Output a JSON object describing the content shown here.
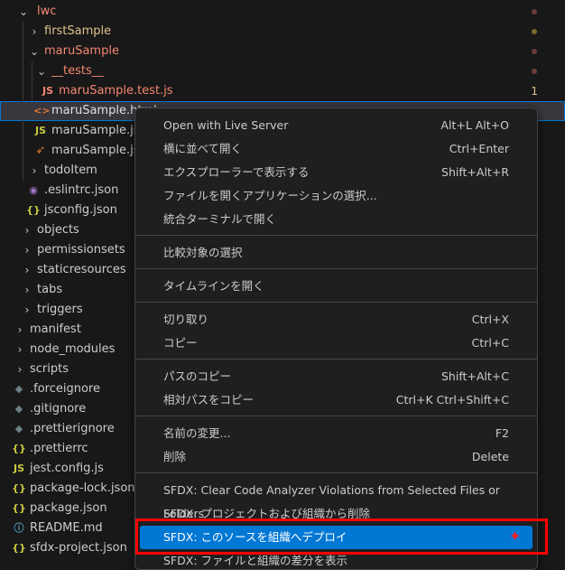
{
  "tree": [
    {
      "label": "lwc",
      "color": "#f48771",
      "dot": "r"
    },
    {
      "label": "firstSample",
      "color": "#e2c08d",
      "dot": "y"
    },
    {
      "label": "maruSample",
      "color": "#f48771",
      "dot": "r"
    },
    {
      "label": "__tests__",
      "color": "#f48771",
      "dot": "r"
    },
    {
      "label": "maruSample.test.js",
      "color": "#f48771",
      "icon": "JS",
      "badge": "1"
    },
    {
      "label": "maruSample.html",
      "icon": "<>"
    },
    {
      "label": "maruSample.js",
      "icon": "JS"
    },
    {
      "label": "maruSample.js-m",
      "icon": "rss"
    },
    {
      "label": "todoItem"
    },
    {
      "label": ".eslintrc.json"
    },
    {
      "label": "jsconfig.json",
      "icon": "{}"
    },
    {
      "label": "objects"
    },
    {
      "label": "permissionsets"
    },
    {
      "label": "staticresources"
    },
    {
      "label": "tabs"
    },
    {
      "label": "triggers"
    },
    {
      "label": "manifest"
    },
    {
      "label": "node_modules"
    },
    {
      "label": "scripts"
    },
    {
      "label": ".forceignore"
    },
    {
      "label": ".gitignore"
    },
    {
      "label": ".prettierignore"
    },
    {
      "label": ".prettierrc",
      "icon": "{}"
    },
    {
      "label": "jest.config.js",
      "icon": "JS"
    },
    {
      "label": "package-lock.json",
      "icon": "{}"
    },
    {
      "label": "package.json",
      "icon": "{}"
    },
    {
      "label": "README.md",
      "icon": "i"
    },
    {
      "label": "sfdx-project.json",
      "icon": "{}"
    }
  ],
  "menu": {
    "open_live": {
      "label": "Open with Live Server",
      "key": "Alt+L Alt+O"
    },
    "open_side": {
      "label": "横に並べて開く",
      "key": "Ctrl+Enter"
    },
    "reveal": {
      "label": "エクスプローラーで表示する",
      "key": "Shift+Alt+R"
    },
    "open_with": {
      "label": "ファイルを開くアプリケーションの選択..."
    },
    "terminal": {
      "label": "統合ターミナルで開く"
    },
    "compare": {
      "label": "比較対象の選択"
    },
    "timeline": {
      "label": "タイムラインを開く"
    },
    "cut": {
      "label": "切り取り",
      "key": "Ctrl+X"
    },
    "copy": {
      "label": "コピー",
      "key": "Ctrl+C"
    },
    "copy_path": {
      "label": "パスのコピー",
      "key": "Shift+Alt+C"
    },
    "copy_rel": {
      "label": "相対パスをコピー",
      "key": "Ctrl+K Ctrl+Shift+C"
    },
    "rename": {
      "label": "名前の変更...",
      "key": "F2"
    },
    "delete": {
      "label": "削除",
      "key": "Delete"
    },
    "sfdx_clear": {
      "label": "SFDX: Clear Code Analyzer Violations from Selected Files or Folders"
    },
    "sfdx_delete": {
      "label": "SFDX: プロジェクトおよび組織から削除"
    },
    "sfdx_deploy": {
      "label": "SFDX: このソースを組織へデプロイ"
    },
    "sfdx_diff": {
      "label": "SFDX: ファイルと組織の差分を表示"
    }
  },
  "annotation_star": "✦"
}
